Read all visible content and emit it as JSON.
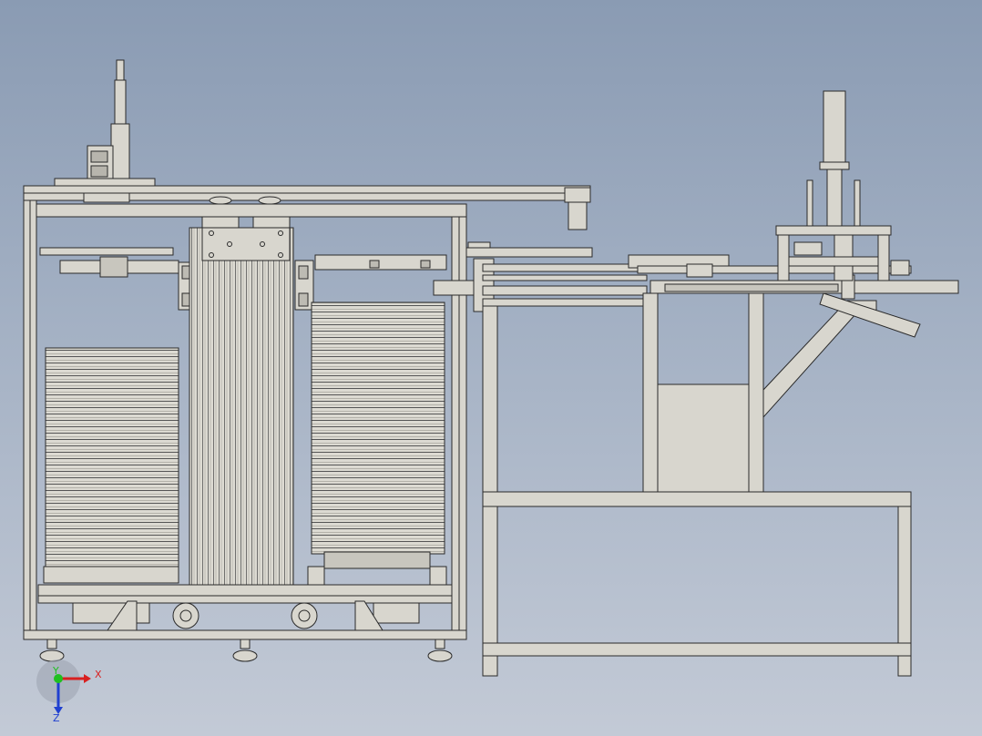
{
  "view": {
    "background_top": "#8a9bb3",
    "background_bottom": "#c3cad6",
    "part_fill": "#d8d6ce",
    "part_stroke": "#2a2a2a"
  },
  "triad": {
    "x_label": "X",
    "y_label": "Y",
    "z_label": "Z",
    "x_color": "#d82020",
    "y_color": "#20c020",
    "z_color": "#2040d0"
  }
}
